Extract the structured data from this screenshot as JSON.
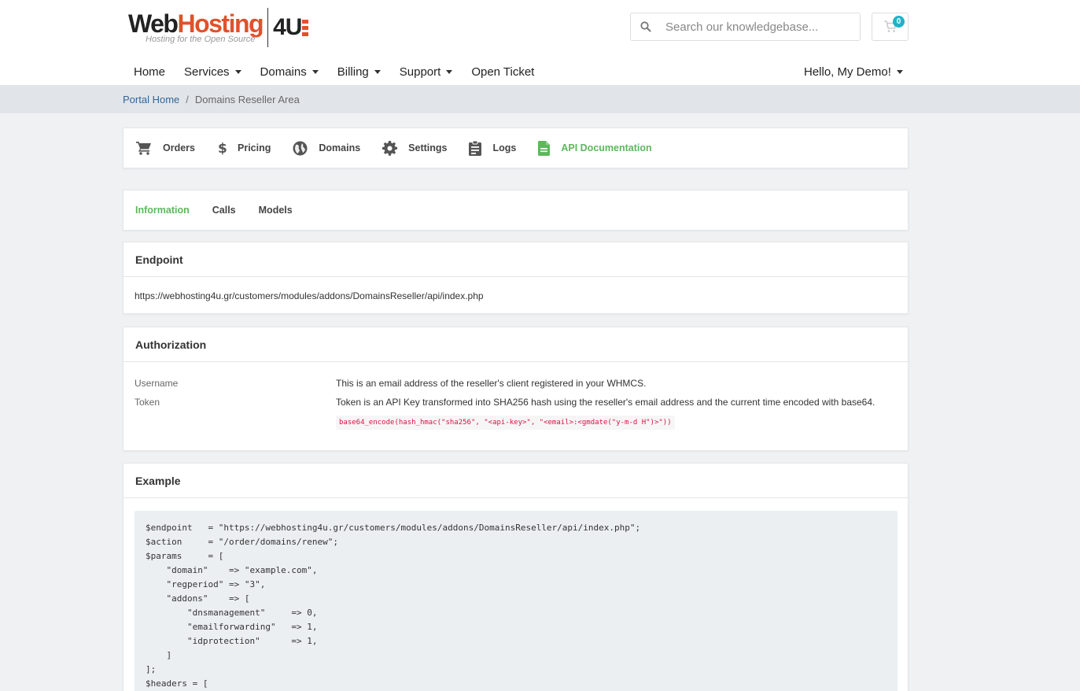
{
  "brand": {
    "logo_main_a": "Web",
    "logo_main_b": "Hosting",
    "logo_sub": "Hosting for the Open Source",
    "logo_4u": "4U"
  },
  "search": {
    "placeholder": "Search our knowledgebase..."
  },
  "cart": {
    "count": "0"
  },
  "nav": {
    "items": [
      {
        "label": "Home",
        "dropdown": false
      },
      {
        "label": "Services",
        "dropdown": true
      },
      {
        "label": "Domains",
        "dropdown": true
      },
      {
        "label": "Billing",
        "dropdown": true
      },
      {
        "label": "Support",
        "dropdown": true
      },
      {
        "label": "Open Ticket",
        "dropdown": false
      }
    ],
    "user": "Hello, My Demo!"
  },
  "breadcrumb": {
    "home": "Portal Home",
    "separator": "/",
    "current": "Domains Reseller Area"
  },
  "reseller_nav": {
    "items": [
      {
        "label": "Orders",
        "icon": "cart-icon"
      },
      {
        "label": "Pricing",
        "icon": "dollar-icon"
      },
      {
        "label": "Domains",
        "icon": "globe-icon"
      },
      {
        "label": "Settings",
        "icon": "gear-icon"
      },
      {
        "label": "Logs",
        "icon": "clipboard-icon"
      },
      {
        "label": "API Documentation",
        "icon": "document-icon"
      }
    ],
    "active": "API Documentation",
    "active_color": "#5cb85c"
  },
  "doc_tabs": {
    "items": [
      "Information",
      "Calls",
      "Models"
    ],
    "active": "Information"
  },
  "endpoint": {
    "title": "Endpoint",
    "url": "https://webhosting4u.gr/customers/modules/addons/DomainsReseller/api/index.php"
  },
  "authorization": {
    "title": "Authorization",
    "username_label": "Username",
    "username_desc": "This is an email address of the reseller's client registered in your WHMCS.",
    "token_label": "Token",
    "token_desc": "Token is an API Key transformed into SHA256 hash using the reseller's email address and the current time encoded with base64.",
    "token_code": "base64_encode(hash_hmac(\"sha256\", \"<api-key>\", \"<email>:<gmdate(\"y-m-d H\")>\"))"
  },
  "example": {
    "title": "Example",
    "code": "$endpoint   = \"https://webhosting4u.gr/customers/modules/addons/DomainsReseller/api/index.php\";\n$action     = \"/order/domains/renew\";\n$params     = [\n    \"domain\"    => \"example.com\",\n    \"regperiod\" => \"3\",\n    \"addons\"    => [\n        \"dnsmanagement\"     => 0,\n        \"emailforwarding\"   => 1,\n        \"idprotection\"      => 1,\n    ]\n];\n$headers = ["
  }
}
